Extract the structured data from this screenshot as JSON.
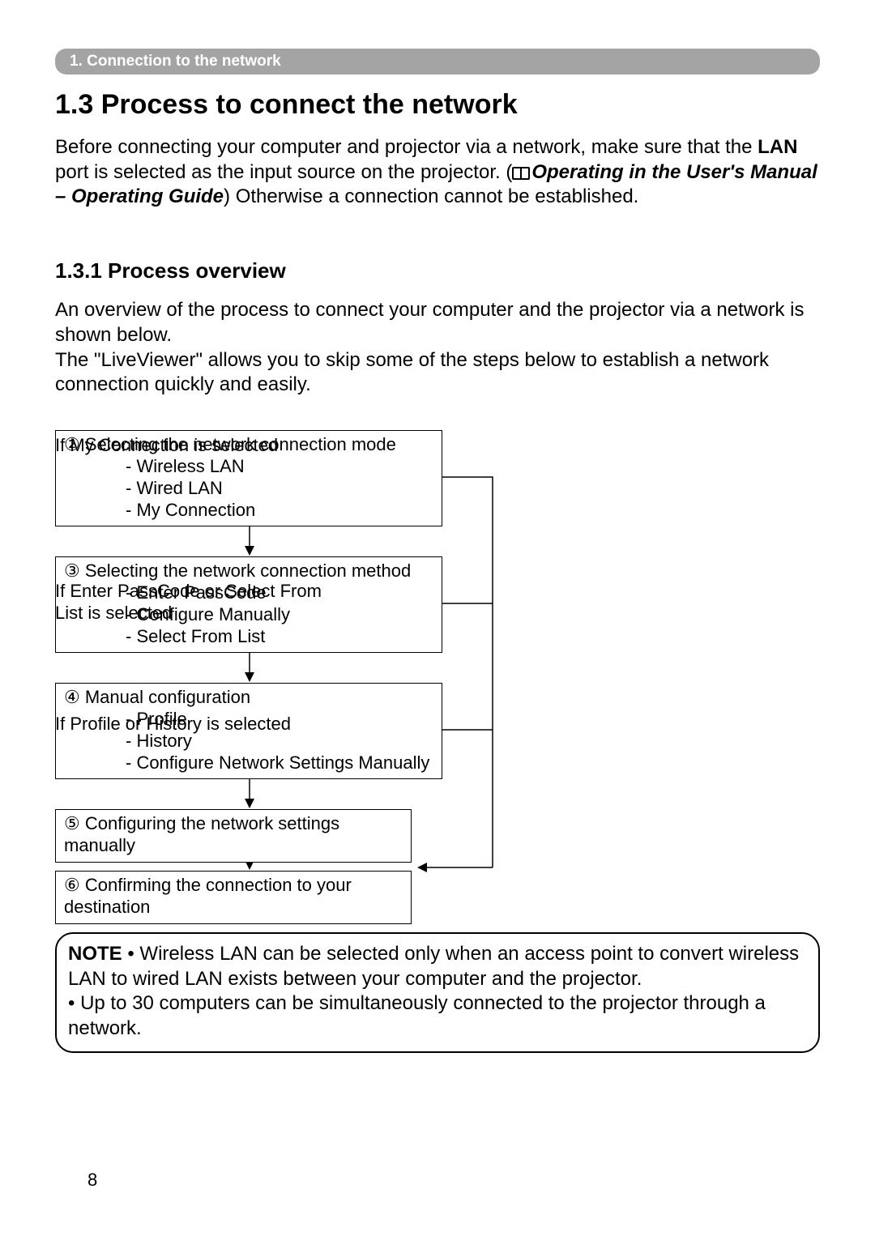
{
  "header": {
    "breadcrumb": "1. Connection to the network"
  },
  "section": {
    "title": "1.3 Process to connect the network",
    "intro_before_lan": "Before connecting your computer and projector via a network, make sure that the ",
    "lan": "LAN",
    "intro_after_lan": " port is selected as the input source on the projector. (",
    "ref": "Operating in the User's Manual – Operating Guide",
    "intro_after_ref": ") Otherwise a connection cannot be established."
  },
  "subsection": {
    "title": "1.3.1 Process overview",
    "para1": "An overview of the process to connect your computer and the projector via a network is shown below.",
    "para2": "The \"LiveViewer\" allows you to skip some of the steps below to establish a network connection quickly and easily."
  },
  "diagram": {
    "box1_line1": "② Selecting the network connection mode",
    "box1_items": [
      "- Wireless LAN",
      "- Wired LAN",
      "- My Connection"
    ],
    "side1": "If My Connection is selected",
    "box2_line1": "③ Selecting the network connection method",
    "box2_items": [
      "- Enter PassCode",
      "- Conﬁgure Manually",
      "- Select From List"
    ],
    "side2": "If Enter PassCode or Select From List is selected",
    "box3_line1": "④ Manual conﬁguration",
    "box3_items": [
      "- Proﬁle",
      "- History",
      "- Conﬁgure Network Settings Manually"
    ],
    "side3": "If Proﬁle or History is selected",
    "box4_line1": "⑤ Conﬁguring the network settings manually",
    "box5_line1": "⑥ Conﬁrming the connection to your destination"
  },
  "note": {
    "label": "NOTE",
    "bullet1": " • Wireless LAN can be selected only when an access point to convert wireless LAN to wired LAN exists between your computer and the projector.",
    "bullet2": "• Up to 30 computers can be simultaneously connected to the projector through a network."
  },
  "page_number": "8"
}
